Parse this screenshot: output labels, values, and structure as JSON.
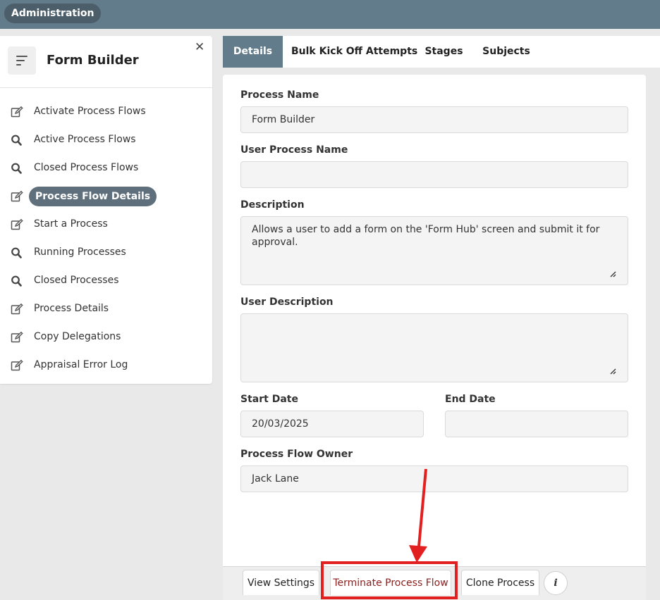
{
  "topbar": {
    "admin_label": "Administration"
  },
  "sidebar": {
    "title": "Form Builder",
    "close_glyph": "✕",
    "items": [
      {
        "label": "Activate Process Flows",
        "icon": "edit-icon"
      },
      {
        "label": "Active Process Flows",
        "icon": "search-icon"
      },
      {
        "label": "Closed Process Flows",
        "icon": "search-icon"
      },
      {
        "label": "Process Flow Details",
        "icon": "edit-icon",
        "active": true
      },
      {
        "label": "Start a Process",
        "icon": "edit-icon"
      },
      {
        "label": "Running Processes",
        "icon": "search-icon"
      },
      {
        "label": "Closed Processes",
        "icon": "search-icon"
      },
      {
        "label": "Process Details",
        "icon": "edit-icon"
      },
      {
        "label": "Copy Delegations",
        "icon": "edit-icon"
      },
      {
        "label": "Appraisal Error Log",
        "icon": "edit-icon"
      }
    ]
  },
  "tabs": [
    {
      "label": "Details",
      "active": true
    },
    {
      "label": "Bulk Kick Off Attempts"
    },
    {
      "label": "Stages"
    },
    {
      "label": "Subjects"
    }
  ],
  "form": {
    "process_name_label": "Process Name",
    "process_name_value": "Form Builder",
    "user_process_name_label": "User Process Name",
    "user_process_name_value": "",
    "description_label": "Description",
    "description_value": "Allows a user to add a form on the 'Form Hub' screen and submit it for approval.",
    "user_description_label": "User Description",
    "user_description_value": "",
    "start_date_label": "Start Date",
    "start_date_value": "20/03/2025",
    "end_date_label": "End Date",
    "end_date_value": "",
    "owner_label": "Process Flow Owner",
    "owner_value": "Jack Lane"
  },
  "footer": {
    "view_settings_label": "View Settings",
    "terminate_label": "Terminate Process Flow",
    "clone_label": "Clone Process",
    "info_glyph": "i"
  },
  "colors": {
    "header_bg": "#637c8b",
    "active_pill": "#5f6f7b",
    "highlight": "#e32020",
    "danger_text": "#8a1f1f"
  }
}
